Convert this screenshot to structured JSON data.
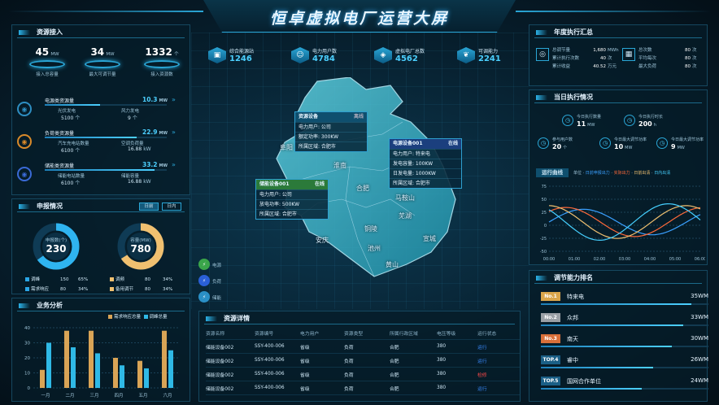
{
  "header": {
    "title": "恒卓虚拟电厂运营大屏"
  },
  "resource_access": {
    "title": "资源接入",
    "metrics": [
      {
        "value": "45",
        "unit": "MW",
        "label": "接入总容量"
      },
      {
        "value": "34",
        "unit": "MW",
        "label": "最大可调节量"
      },
      {
        "value": "1332",
        "unit": "个",
        "label": "接入资源数"
      }
    ],
    "rows": [
      {
        "title": "电源类资源量",
        "value": "10.3",
        "unit": "MW",
        "fill": 0.45,
        "left_label": "光伏发电",
        "left_val": "5100",
        "left_unit": "个",
        "right_label": "风力发电",
        "right_val": "9",
        "right_unit": "个"
      },
      {
        "title": "负荷类资源量",
        "value": "22.9",
        "unit": "MW",
        "fill": 0.75,
        "left_label": "汽车充电站数量",
        "left_val": "6100",
        "left_unit": "个",
        "right_label": "空调负荷量",
        "right_val": "16.88",
        "right_unit": "kW"
      },
      {
        "title": "储能类资源量",
        "value": "33.2",
        "unit": "MW",
        "fill": 0.9,
        "left_label": "储能电站数量",
        "left_val": "6100",
        "left_unit": "个",
        "right_label": "储能容量",
        "right_val": "16.88",
        "right_unit": "kW"
      }
    ]
  },
  "declaration": {
    "title": "申报情况",
    "tabs": [
      "日前",
      "日内"
    ],
    "donuts": [
      {
        "label": "申报数(个)",
        "value": "230",
        "fill": 0.65
      },
      {
        "label": "容量(MW)",
        "value": "780",
        "fill": 0.66
      }
    ],
    "legend": [
      {
        "name": "调峰",
        "count": "150",
        "pct": "65%",
        "color": "#2aa6e6"
      },
      {
        "name": "调频",
        "count": "80",
        "pct": "34%",
        "color": "#f0c070"
      },
      {
        "name": "需求响应",
        "count": "80",
        "pct": "34%",
        "color": "#2aa6e6"
      },
      {
        "name": "备用调节",
        "count": "80",
        "pct": "34%",
        "color": "#f0c070"
      }
    ]
  },
  "business": {
    "title": "业务分析",
    "legend": [
      "需求响应总量",
      "调峰总量"
    ],
    "legend_colors": [
      "#d9a456",
      "#2fb9e6"
    ]
  },
  "chart_data": {
    "type": "bar",
    "categories": [
      "一月",
      "二月",
      "三月",
      "四月",
      "五月",
      "六月"
    ],
    "series": [
      {
        "name": "需求响应总量",
        "values": [
          12,
          38,
          38,
          20,
          18,
          38
        ]
      },
      {
        "name": "调峰总量",
        "values": [
          30,
          27,
          23,
          15,
          13,
          25
        ]
      }
    ],
    "ylim": [
      0,
      40
    ],
    "yticks": [
      0,
      10,
      20,
      30,
      40
    ]
  },
  "stats": [
    {
      "label": "综合能源站",
      "value": "1246",
      "icon": "station-icon"
    },
    {
      "label": "电力用户数",
      "value": "4784",
      "icon": "users-icon"
    },
    {
      "label": "虚拟电厂总数",
      "value": "4562",
      "icon": "plant-icon"
    },
    {
      "label": "可调能力",
      "value": "2241",
      "icon": "leaf-icon"
    }
  ],
  "map": {
    "cities": [
      "阜阳",
      "淮南",
      "合肥",
      "马鞍山",
      "芜湖",
      "铜陵",
      "安庆",
      "池州",
      "宣城",
      "黄山"
    ],
    "popups": [
      {
        "title": "资源设备",
        "status": "离线",
        "lines": [
          "电力用户: 公司",
          "额定功率: 300KW",
          "所属区域: 合肥市"
        ]
      },
      {
        "title": "电源设备001",
        "status": "在线",
        "lines": [
          "电力用户: 特来电",
          "发电容量: 100KW",
          "日发电量: 1000KW",
          "所属区域: 合肥市"
        ]
      },
      {
        "title": "储能设备001",
        "status": "在线",
        "lines": [
          "电力用户: 公司",
          "放电功率: 500KW",
          "所属区域: 合肥市"
        ]
      }
    ],
    "side_legend": [
      {
        "label": "电源",
        "color": "#3aa54a"
      },
      {
        "label": "负荷",
        "color": "#2a5fd6"
      },
      {
        "label": "储能",
        "color": "#2a8fc6"
      }
    ]
  },
  "resource_detail": {
    "title": "资源详情",
    "columns": [
      "资源名称",
      "资源编号",
      "电力用户",
      "资源类型",
      "所属行政区域",
      "电压等级",
      "运行状态"
    ],
    "rows": [
      [
        "储能设备002",
        "SSY-400-006",
        "省级",
        "负荷",
        "合肥",
        "380",
        "运行"
      ],
      [
        "储能设备002",
        "SSY-400-006",
        "省级",
        "负荷",
        "合肥",
        "380",
        "运行"
      ],
      [
        "储能设备002",
        "SSY-400-006",
        "省级",
        "负荷",
        "合肥",
        "380",
        "检修"
      ],
      [
        "储能设备002",
        "SSY-400-006",
        "省级",
        "负荷",
        "合肥",
        "380",
        "运行"
      ]
    ]
  },
  "annual": {
    "title": "年度执行汇总",
    "left": [
      [
        "总调节量",
        "1,680",
        "MWh"
      ],
      [
        "累计执行次数",
        "40",
        "次"
      ],
      [
        "累计收益",
        "40.52",
        "万元"
      ]
    ],
    "right": [
      [
        "总次数",
        "80",
        "次"
      ],
      [
        "平均每次",
        "80",
        "次"
      ],
      [
        "最大负荷",
        "80",
        "次"
      ]
    ]
  },
  "daily": {
    "title": "当日执行情况",
    "items": [
      {
        "label": "今日执行数量",
        "value": "11",
        "unit": "MW"
      },
      {
        "label": "今日执行时长",
        "value": "200",
        "unit": "h"
      },
      {
        "label": "参与用户数",
        "value": "20",
        "unit": "个"
      },
      {
        "label": "今日最大调节功率",
        "value": "10",
        "unit": "MW"
      },
      {
        "label": "今日最大调节功率",
        "value": "9",
        "unit": "MW"
      }
    ],
    "curve_title": "运行曲线",
    "curve_legend": [
      "日前申报出力",
      "实际出力",
      "日前出清",
      "日内出清"
    ],
    "curve_unit": "单位",
    "x_ticks": [
      "00:00",
      "01:00",
      "02:00",
      "03:00",
      "04:00",
      "05:00",
      "06:00"
    ],
    "y_ticks": [
      "-50",
      "-25",
      "0",
      "25",
      "50",
      "75"
    ]
  },
  "ranking": {
    "title": "调节能力排名",
    "items": [
      {
        "rank": "No.1",
        "name": "特来电",
        "value": "35WM",
        "color": "#d9a54b",
        "fill": 0.9
      },
      {
        "rank": "No.2",
        "name": "众邦",
        "value": "33WM",
        "color": "#9aa0a6",
        "fill": 0.85
      },
      {
        "rank": "No.3",
        "name": "南天",
        "value": "30WM",
        "color": "#d9703a",
        "fill": 0.78
      },
      {
        "rank": "TOP.4",
        "name": "睿中",
        "value": "26WM",
        "color": "#1a5f86",
        "fill": 0.67
      },
      {
        "rank": "TOP.5",
        "name": "国网合作单位",
        "value": "24WM",
        "color": "#1a5f86",
        "fill": 0.6
      }
    ]
  }
}
